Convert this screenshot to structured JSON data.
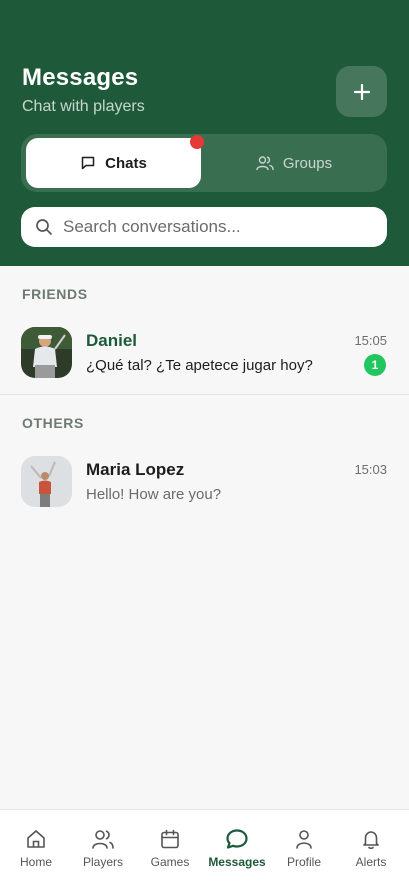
{
  "header": {
    "title": "Messages",
    "subtitle": "Chat with players",
    "add_icon": "plus-icon"
  },
  "tabs": [
    {
      "label": "Chats",
      "icon": "chat-bubble-icon",
      "active": true,
      "has_notification_dot": true
    },
    {
      "label": "Groups",
      "icon": "users-icon",
      "active": false
    }
  ],
  "search": {
    "placeholder": "Search conversations...",
    "value": ""
  },
  "sections": [
    {
      "label": "FRIENDS",
      "conversations": [
        {
          "name": "Daniel",
          "preview": "¿Qué tal? ¿Te apetece jugar hoy?",
          "time": "15:05",
          "unread": "1",
          "name_color": "#1e5a3a"
        }
      ]
    },
    {
      "label": "OTHERS",
      "conversations": [
        {
          "name": "Maria Lopez",
          "preview": "Hello! How are you?",
          "time": "15:03",
          "unread": "",
          "name_color": "#1d1d1d"
        }
      ]
    }
  ],
  "nav": [
    {
      "label": "Home",
      "icon": "home-icon",
      "active": false
    },
    {
      "label": "Players",
      "icon": "users-icon",
      "active": false
    },
    {
      "label": "Games",
      "icon": "calendar-icon",
      "active": false
    },
    {
      "label": "Messages",
      "icon": "chat-bubble-icon",
      "active": true
    },
    {
      "label": "Profile",
      "icon": "person-icon",
      "active": false
    },
    {
      "label": "Alerts",
      "icon": "bell-icon",
      "active": false
    }
  ],
  "colors": {
    "primary": "#1e5a3a",
    "badge": "#22c55e",
    "notification_dot": "#e53935"
  }
}
